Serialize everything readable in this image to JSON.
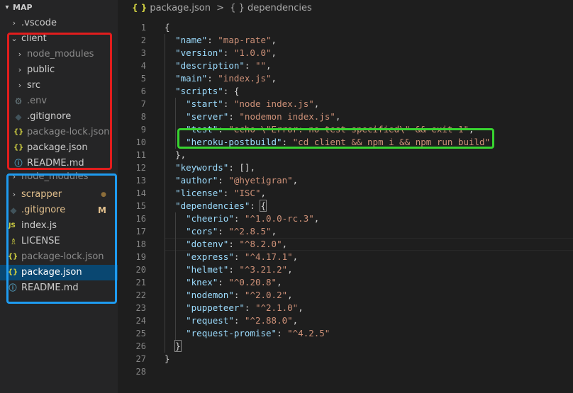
{
  "explorer": {
    "title": "MAP",
    "items": [
      {
        "label": ".vscode",
        "icon": "chevron-right"
      },
      {
        "label": "client",
        "icon": "chevron-down"
      },
      {
        "label": "node_modules",
        "icon": "chevron-right"
      },
      {
        "label": "public",
        "icon": "chevron-right"
      },
      {
        "label": "src",
        "icon": "chevron-right"
      },
      {
        "label": ".env",
        "icon": "gear-icon"
      },
      {
        "label": ".gitignore",
        "icon": "git-icon"
      },
      {
        "label": "package-lock.json",
        "icon": "json-icon"
      },
      {
        "label": "package.json",
        "icon": "json-icon"
      },
      {
        "label": "README.md",
        "icon": "info-icon"
      },
      {
        "label": "node_modules",
        "icon": "chevron-right"
      },
      {
        "label": "scrapper",
        "icon": "chevron-right",
        "badge": "●"
      },
      {
        "label": ".gitignore",
        "icon": "git-icon",
        "badge": "M"
      },
      {
        "label": "index.js",
        "icon": "js-icon",
        "icon_text": "JS"
      },
      {
        "label": "LICENSE",
        "icon": "license-icon"
      },
      {
        "label": "package-lock.json",
        "icon": "json-icon"
      },
      {
        "label": "package.json",
        "icon": "json-icon"
      },
      {
        "label": "README.md",
        "icon": "info-icon"
      }
    ]
  },
  "breadcrumb": {
    "file_icon": "{ }",
    "file": "package.json",
    "separator": ">",
    "node_icon": "{ }",
    "node": "dependencies"
  },
  "editor": {
    "line_numbers": [
      "1",
      "2",
      "3",
      "4",
      "5",
      "6",
      "7",
      "8",
      "9",
      "10",
      "11",
      "12",
      "13",
      "14",
      "15",
      "16",
      "17",
      "18",
      "19",
      "20",
      "21",
      "22",
      "23",
      "24",
      "25",
      "26",
      "27",
      "28"
    ],
    "lines": [
      "{",
      "  \"name\": \"map-rate\",",
      "  \"version\": \"1.0.0\",",
      "  \"description\": \"\",",
      "  \"main\": \"index.js\",",
      "  \"scripts\": {",
      "    \"start\": \"node index.js\",",
      "    \"server\": \"nodemon index.js\",",
      "    \"test\": \"echo \\\"Error: no test specified\\\" && exit 1\",",
      "    \"heroku-postbuild\": \"cd client && npm i && npm run build\"",
      "  },",
      "  \"keywords\": [],",
      "  \"author\": \"@hyetigran\",",
      "  \"license\": \"ISC\",",
      "  \"dependencies\": {",
      "    \"cheerio\": \"^1.0.0-rc.3\",",
      "    \"cors\": \"^2.8.5\",",
      "    \"dotenv\": \"^8.2.0\",",
      "    \"express\": \"^4.17.1\",",
      "    \"helmet\": \"^3.21.2\",",
      "    \"knex\": \"^0.20.8\",",
      "    \"nodemon\": \"^2.0.2\",",
      "    \"puppeteer\": \"^2.1.0\",",
      "    \"request\": \"^2.88.0\",",
      "    \"request-promise\": \"^4.2.5\"",
      "  }",
      "}",
      ""
    ]
  },
  "colors": {
    "key": "#9cdcfe",
    "string": "#ce9178",
    "punctuation": "#d4d4d4",
    "red_highlight": "#e11d1d",
    "blue_highlight": "#1e9bf0",
    "green_highlight": "#38d430"
  }
}
